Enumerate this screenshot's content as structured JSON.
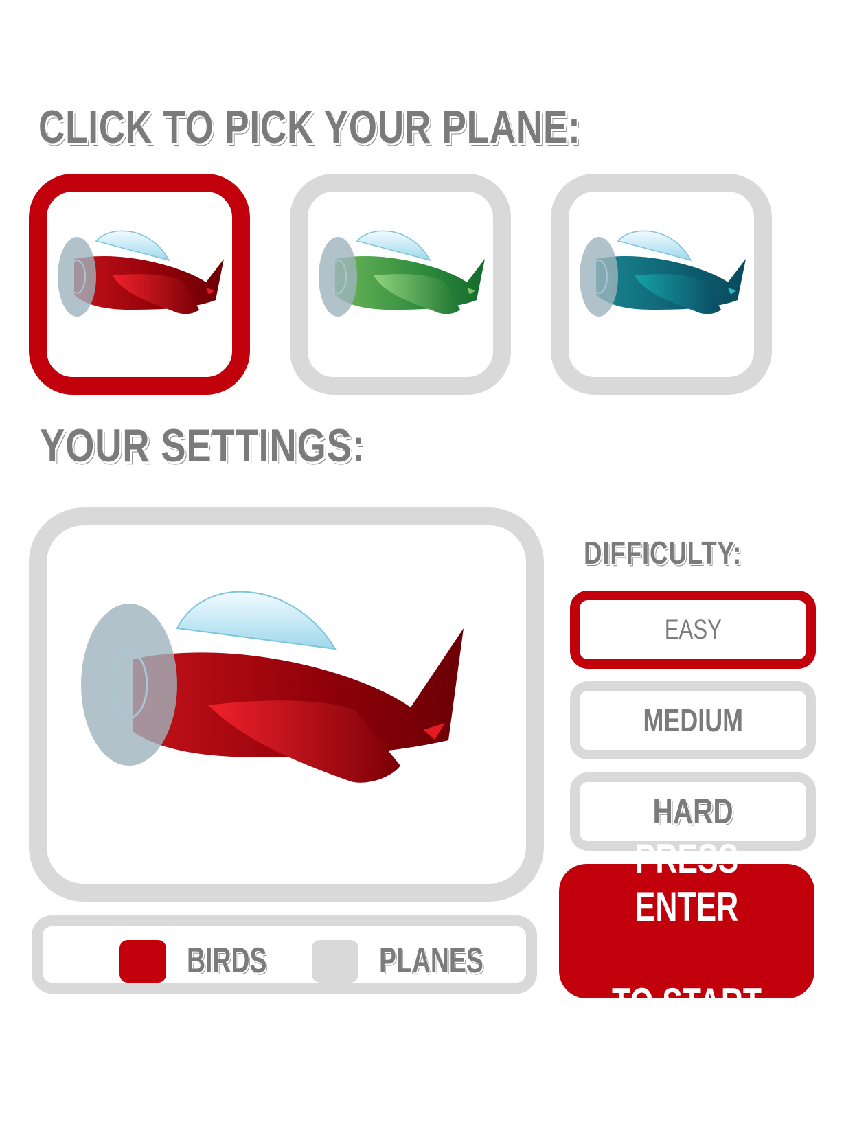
{
  "headings": {
    "pick": "CLICK TO PICK YOUR PLANE:",
    "settings": "YOUR SETTINGS:",
    "difficulty": "DIFFICULTY:"
  },
  "planes": [
    {
      "color": "red",
      "selected": true
    },
    {
      "color": "green",
      "selected": false
    },
    {
      "color": "teal",
      "selected": false
    }
  ],
  "legend": {
    "birds": "BIRDS",
    "planes": "PLANES"
  },
  "difficulty": {
    "options": [
      "EASY",
      "MEDIUM",
      "HARD"
    ],
    "selected": "EASY"
  },
  "start": {
    "line1": "PRESS ENTER",
    "line2": "TO START"
  },
  "colors": {
    "selected_border": "#c1000b",
    "unselected_border": "#d9d9d9",
    "birds_swatch": "#c1000b",
    "planes_swatch": "#d9d9d9",
    "heading_text": "#7b7b7b",
    "start_button": "#c1000b"
  }
}
